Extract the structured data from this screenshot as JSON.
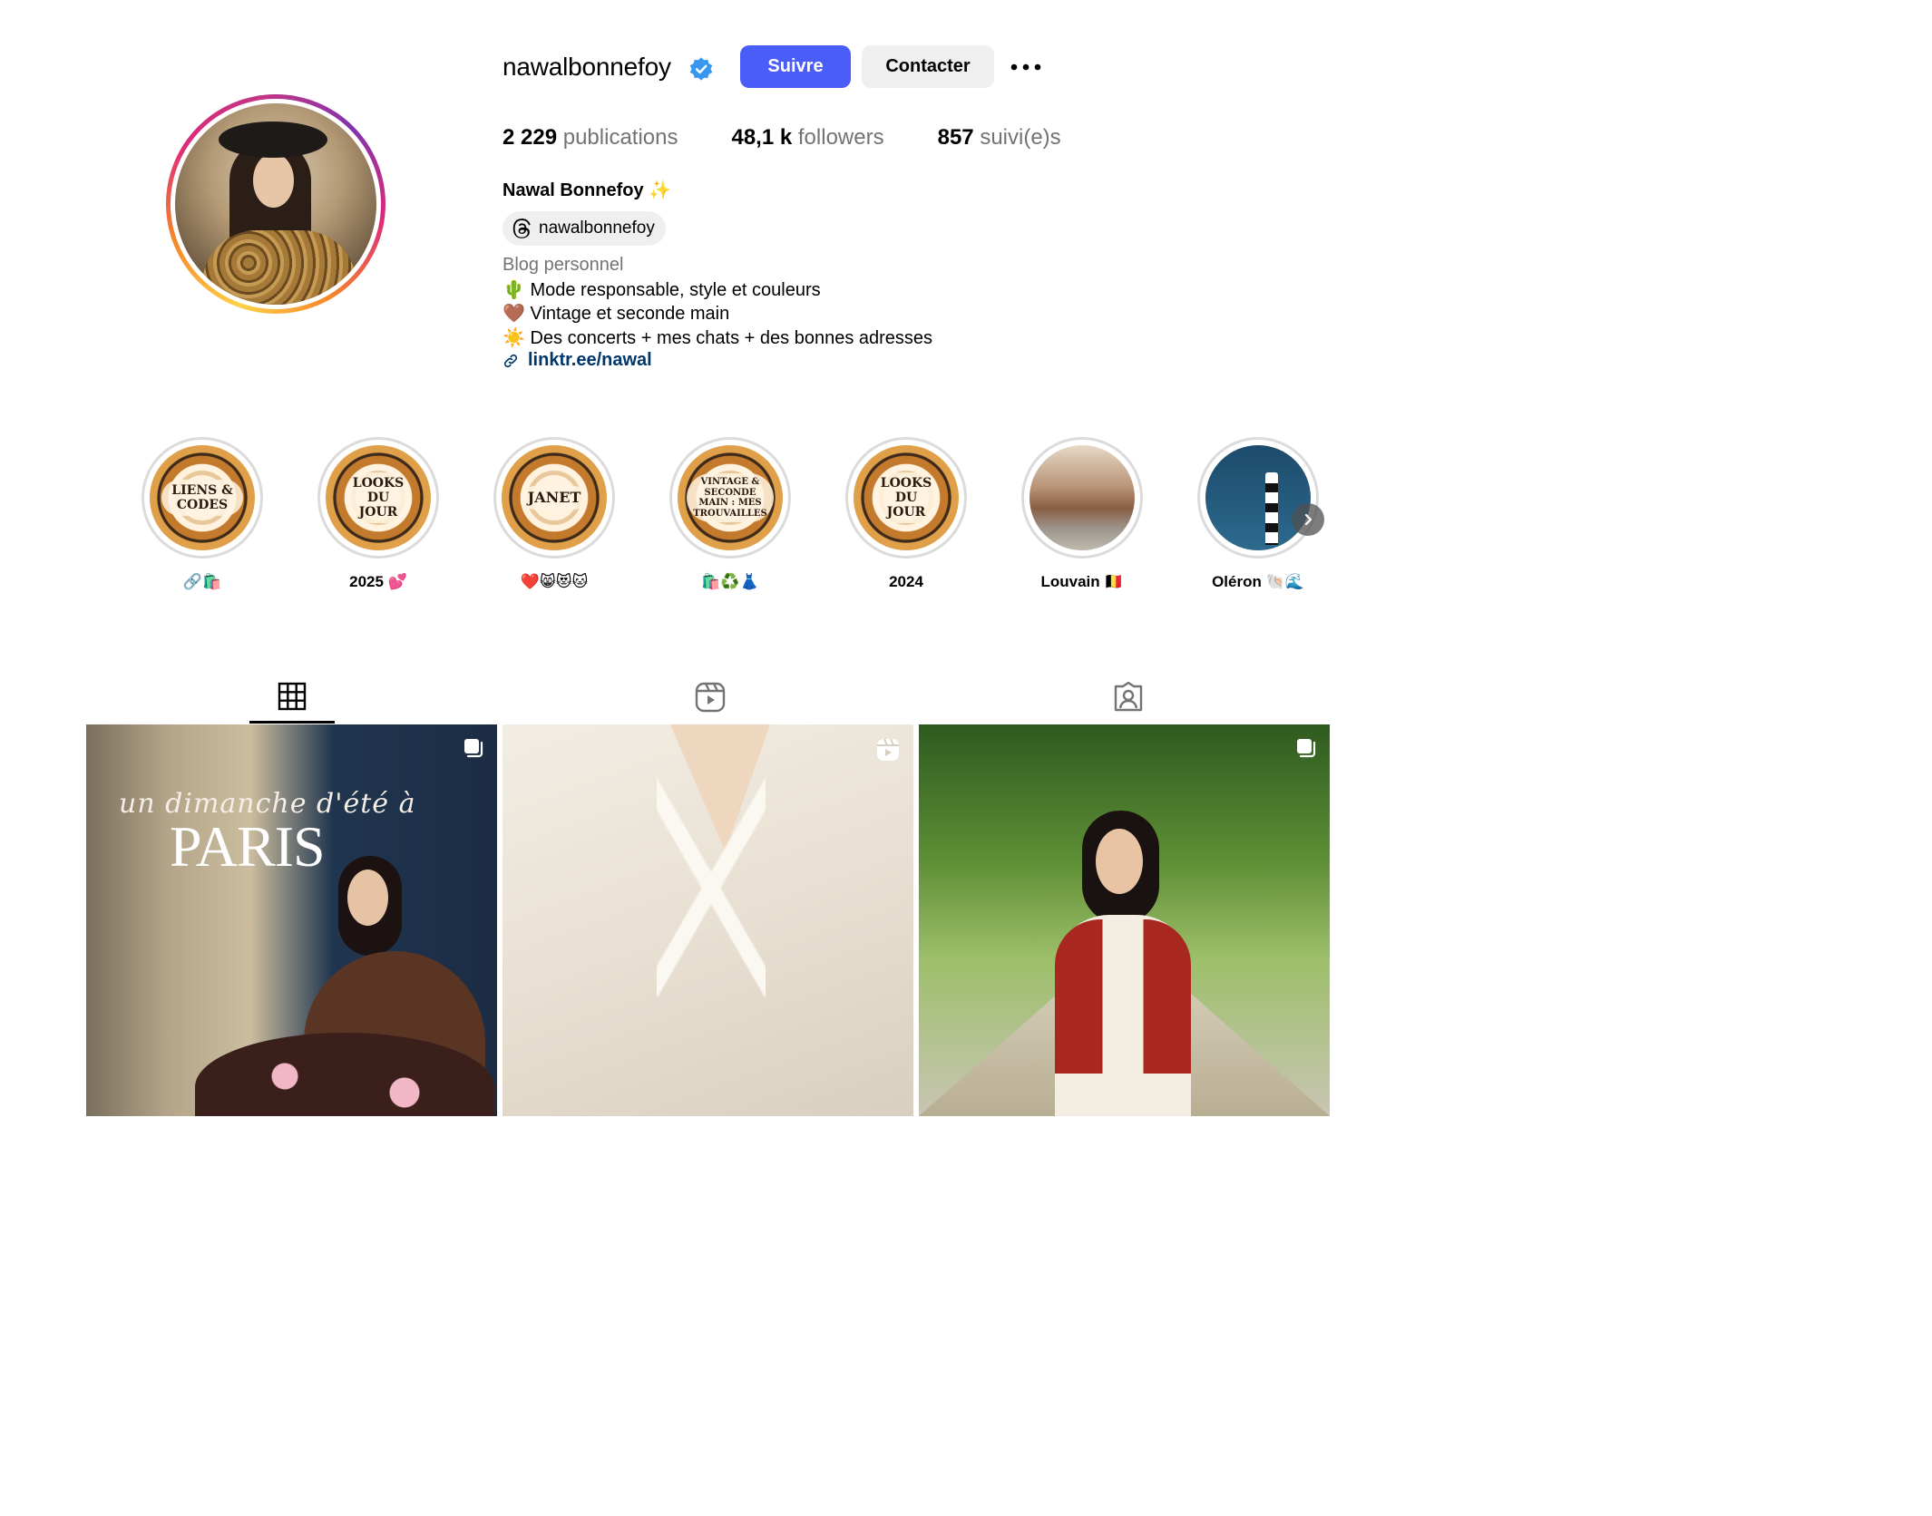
{
  "profile": {
    "username": "nawalbonnefoy",
    "verified": true,
    "follow_label": "Suivre",
    "contact_label": "Contacter",
    "full_name": "Nawal Bonnefoy ✨",
    "threads_handle": "nawalbonnefoy",
    "bio_category": "Blog personnel",
    "bio_lines": [
      "🌵 Mode responsable, style et couleurs",
      "🤎 Vintage et seconde main",
      "☀️ Des concerts + mes chats + des bonnes adresses"
    ],
    "link_text": "linktr.ee/nawal"
  },
  "stats": [
    {
      "value": "2 229",
      "label": "publications"
    },
    {
      "value": "48,1 k",
      "label": "followers"
    },
    {
      "value": "857",
      "label": "suivi(e)s"
    }
  ],
  "highlights": [
    {
      "cover_text": "LIENS & CODES",
      "label": "🔗🛍️"
    },
    {
      "cover_text": "LOOKS DU JOUR",
      "label": "2025 💕"
    },
    {
      "cover_text": "JANET",
      "label": "❤️😸😻🐱"
    },
    {
      "cover_text": "VINTAGE & SECONDE MAIN : MES TROUVAILLES",
      "label": "🛍️♻️👗"
    },
    {
      "cover_text": "LOOKS DU JOUR",
      "label": "2024"
    },
    {
      "cover_text": "",
      "label": "Louvain 🇧🇪"
    },
    {
      "cover_text": "",
      "label": "Oléron 🐚🌊"
    }
  ],
  "tabs": [
    {
      "name": "posts",
      "icon": "grid-icon",
      "active": true
    },
    {
      "name": "reels",
      "icon": "reels-icon",
      "active": false
    },
    {
      "name": "tagged",
      "icon": "tagged-icon",
      "active": false
    }
  ],
  "posts": [
    {
      "type": "carousel",
      "overlay_script": "un dimanche d'été à",
      "overlay_title": "PARIS"
    },
    {
      "type": "reel"
    },
    {
      "type": "carousel"
    }
  ],
  "colors": {
    "follow_button": "#4a5df9",
    "secondary_button": "#efefef",
    "link": "#00376b",
    "muted_text": "#737373",
    "verified_badge": "#3897f0"
  }
}
